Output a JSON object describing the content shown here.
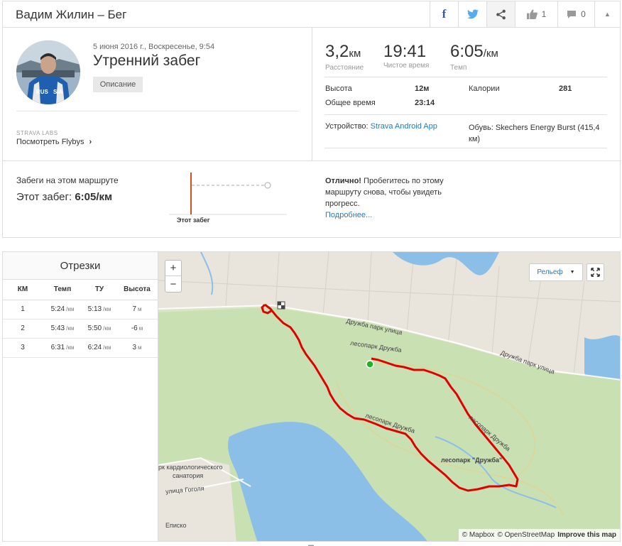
{
  "header": {
    "title": "Вадим Жилин – Бег",
    "kudos_count": "1",
    "comment_count": "0"
  },
  "activity": {
    "date": "5 июня 2016 г., Воскресенье, 9:54",
    "title": "Утренний забег",
    "description_button": "Описание",
    "labs_label": "STRAVA LABS",
    "flyby_link": "Посмотреть Flybys"
  },
  "stats": {
    "distance_value": "3,2",
    "distance_unit": "км",
    "distance_label": "Расстояние",
    "moving_time_value": "19:41",
    "moving_time_label": "Чистое время",
    "pace_value": "6:05",
    "pace_unit": "/км",
    "pace_label": "Темп",
    "elevation_label": "Высота",
    "elevation_value": "12м",
    "calories_label": "Калории",
    "calories_value": "281",
    "elapsed_label": "Общее время",
    "elapsed_value": "23:14",
    "device_label": "Устройство:",
    "device_value": "Strava Android App",
    "shoes_label": "Обувь:",
    "shoes_value": "Skechers Energy Burst (415,4 км)"
  },
  "segment_compare": {
    "label": "Забеги на этом маршруте",
    "current_label": "Этот забег:",
    "current_value": "6:05/км",
    "chart_caption": "Этот забег",
    "note_bold": "Отлично!",
    "note_text": "Пробегитесь по этому маршруту снова, чтобы увидеть прогресс.",
    "note_link": "Подробнее..."
  },
  "splits": {
    "title": "Отрезки",
    "headers": [
      "КМ",
      "Темп",
      "ТУ",
      "Высота"
    ],
    "rows": [
      {
        "km": "1",
        "pace": "5:24",
        "gap": "5:13",
        "elev": "7"
      },
      {
        "km": "2",
        "pace": "5:43",
        "gap": "5:50",
        "elev": "-6"
      },
      {
        "km": "3",
        "pace": "6:31",
        "gap": "6:24",
        "elev": "3"
      }
    ],
    "pace_unit": "/км",
    "elev_unit": "м"
  },
  "map": {
    "zoom_in": "+",
    "zoom_out": "−",
    "layer_label": "Рельеф",
    "attribution_mapbox": "© Mapbox",
    "attribution_osm": "© OpenStreetMap",
    "attribution_improve": "Improve this map",
    "labels": {
      "street_druzhba_1": "Дружба парк улица",
      "street_druzhba_2": "Дружба парк улица",
      "park_1": "лесопарк Дружба",
      "park_2": "лесопарк Дружба",
      "park_3": "лесопарк Дружба",
      "park_main": "лесопарк \"Дружба\"",
      "sanatorium_1": "рк кардиологического",
      "sanatorium_2": "санатория",
      "gogolya": "улица Гоголя",
      "episkopa": "Еписко"
    }
  },
  "colors": {
    "route": "#e00000",
    "map_green": "#c8dfb2",
    "map_water": "#80b5e2",
    "link": "#2a7ab0",
    "start": "#1db41d"
  }
}
